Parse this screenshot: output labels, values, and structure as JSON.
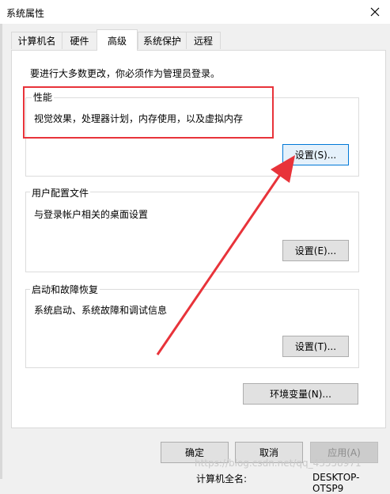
{
  "window": {
    "title": "系统属性"
  },
  "tabs": [
    {
      "label": "计算机名"
    },
    {
      "label": "硬件"
    },
    {
      "label": "高级"
    },
    {
      "label": "系统保护"
    },
    {
      "label": "远程"
    }
  ],
  "notice": "要进行大多数更改，你必须作为管理员登录。",
  "performance": {
    "title": "性能",
    "desc": "视觉效果，处理器计划，内存使用，以及虚拟内存",
    "button": "设置(S)..."
  },
  "user_profiles": {
    "title": "用户配置文件",
    "desc": "与登录帐户相关的桌面设置",
    "button": "设置(E)..."
  },
  "startup_recovery": {
    "title": "启动和故障恢复",
    "desc": "系统启动、系统故障和调试信息",
    "button": "设置(T)..."
  },
  "env_button": "环境变量(N)...",
  "footer": {
    "ok": "确定",
    "cancel": "取消",
    "apply": "应用(A)"
  },
  "watermark": "https://blog.csdn.net/qq_43558971",
  "background_text": {
    "computer_name_label": "计算机全名:",
    "computer_name_value": "DESKTOP-OTSP9"
  },
  "colors": {
    "highlight": "#e8333a",
    "focus_border": "#0078d7"
  }
}
